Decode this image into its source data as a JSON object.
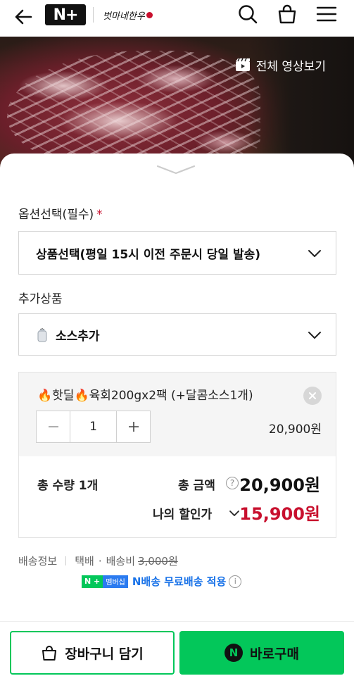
{
  "header": {
    "logo_text": "N+",
    "brand_text": "벗마네한우",
    "icons": [
      "back-arrow-icon",
      "search-icon",
      "shopping-bag-icon",
      "hamburger-menu-icon"
    ]
  },
  "hero": {
    "video_button_label": "전체 영상보기"
  },
  "options": {
    "required_label": "옵션선택(필수)",
    "required_mark": "*",
    "selected_option": "상품선택(평일 15시 이전 주문시 당일 발송)",
    "addon_label": "추가상품",
    "addon_value": "소스추가"
  },
  "item": {
    "title": "🔥핫딜🔥육회200gx2팩 (+달콤소스1개)",
    "quantity": "1",
    "price": "20,900원"
  },
  "totals": {
    "quantity_label": "총 수량 1개",
    "amount_label": "총 금액",
    "amount_help": "?",
    "amount": "20,900원",
    "discount_label": "나의 할인가",
    "discount_price": "15,900원"
  },
  "shipping": {
    "label": "배송정보",
    "method": "택배",
    "dot": "·",
    "fee_label": "배송비",
    "fee": "3,000원",
    "badge_np": "N +",
    "badge_member": "멤버십",
    "membership_text": "N배송 무료배송 적용",
    "info": "i"
  },
  "buttons": {
    "cart": "장바구니 담기",
    "buy": "바로구매",
    "buy_mark": "N"
  },
  "colors": {
    "brand_green": "#03c75a",
    "discount_red": "#c8102e",
    "membership_blue": "#1a73e8"
  }
}
